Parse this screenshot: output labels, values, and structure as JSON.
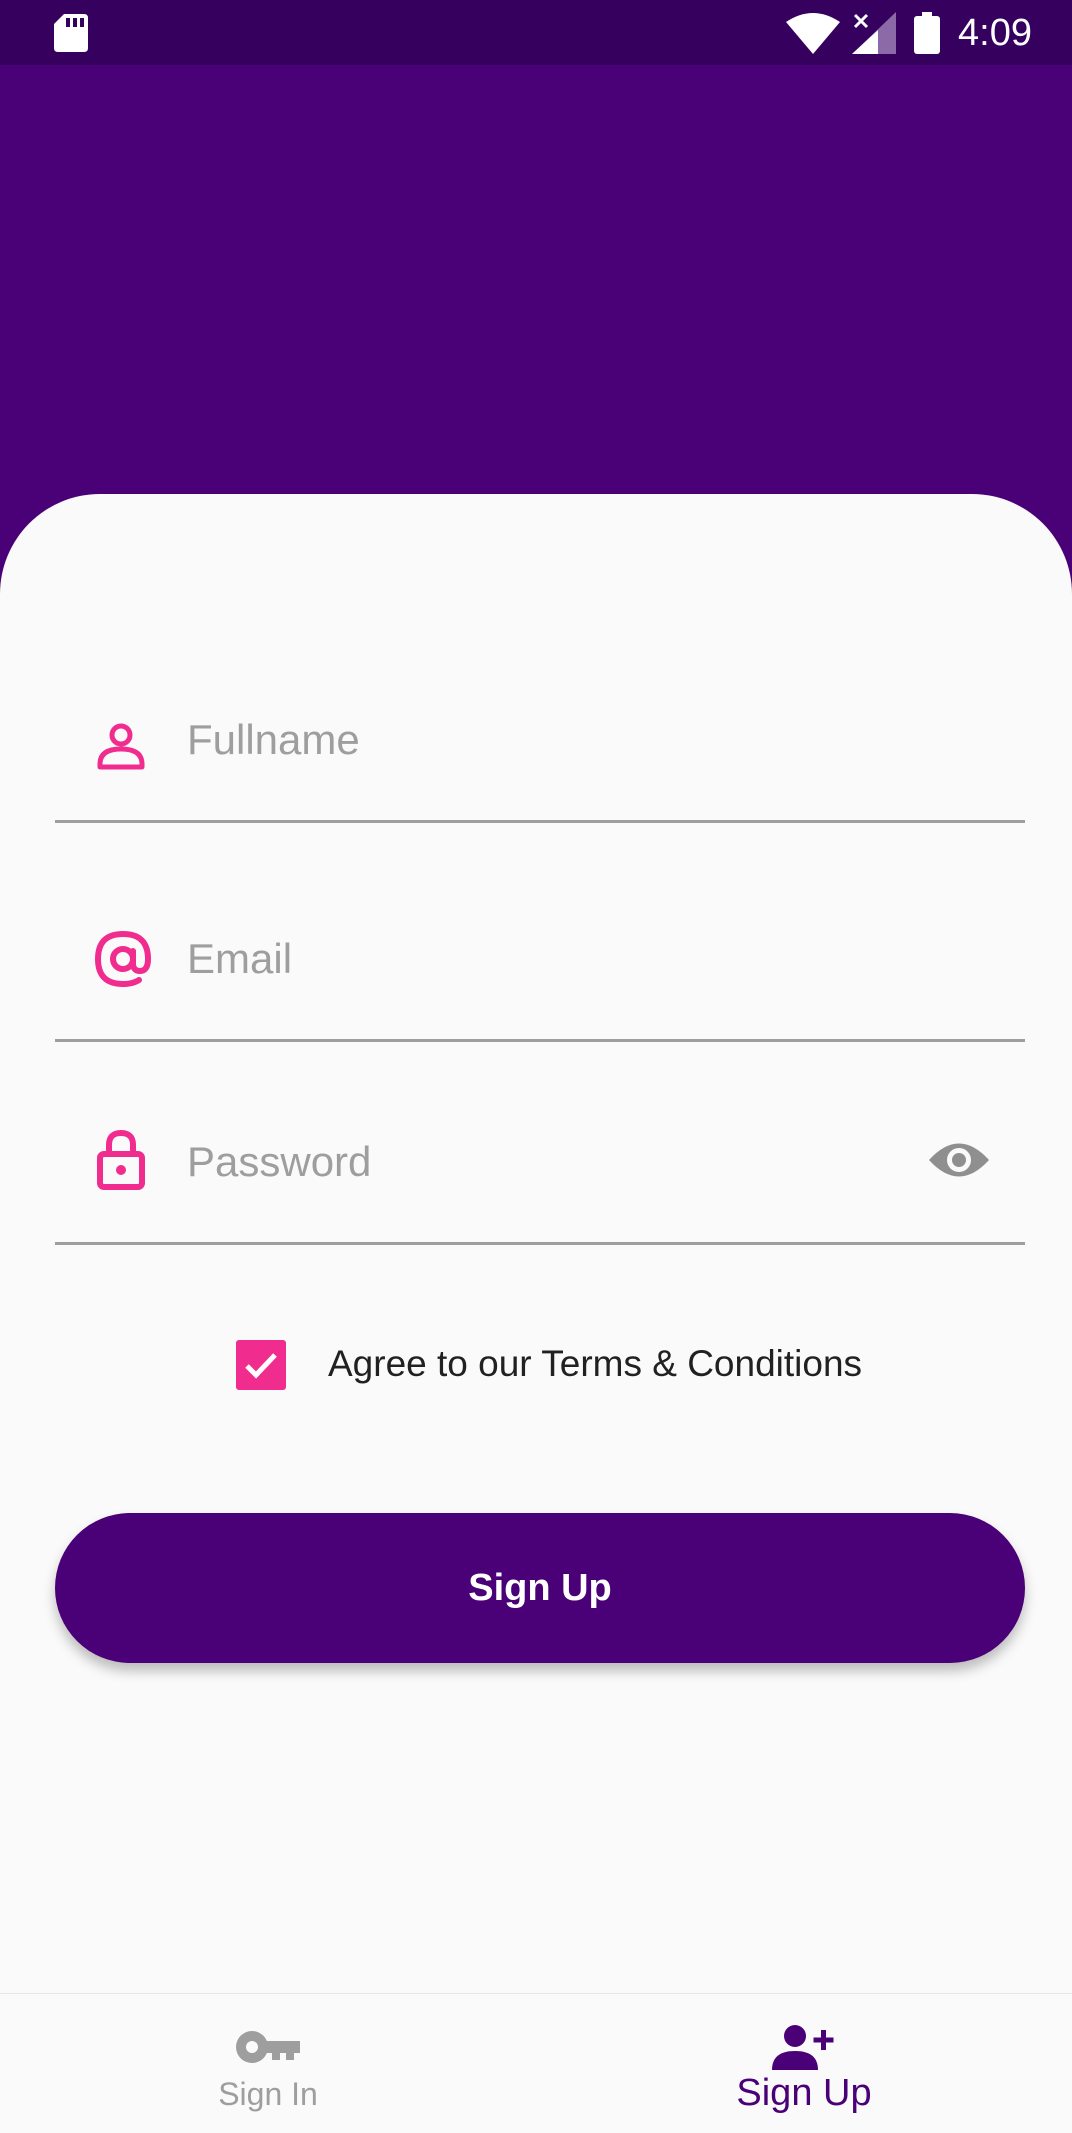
{
  "status_bar": {
    "time": "4:09",
    "icons": [
      "sd-card-icon",
      "wifi-icon",
      "signal-no-data-icon",
      "battery-icon"
    ]
  },
  "form": {
    "fullname": {
      "placeholder": "Fullname",
      "value": "",
      "icon": "person-icon"
    },
    "email": {
      "placeholder": "Email",
      "value": "",
      "icon": "at-sign-icon"
    },
    "password": {
      "placeholder": "Password",
      "value": "",
      "icon": "lock-icon",
      "toggle_icon": "eye-icon"
    },
    "terms": {
      "label": "Agree to our Terms & Conditions",
      "checked": true
    },
    "submit_label": "Sign Up"
  },
  "bottom_nav": {
    "items": [
      {
        "label": "Sign In",
        "icon": "key-icon",
        "active": false
      },
      {
        "label": "Sign Up",
        "icon": "person-add-icon",
        "active": true
      }
    ]
  },
  "colors": {
    "status_bar": "#36005E",
    "primary": "#4A0077",
    "accent": "#F02C8E",
    "muted": "#9E9E9E",
    "background": "#FAFAFA"
  }
}
